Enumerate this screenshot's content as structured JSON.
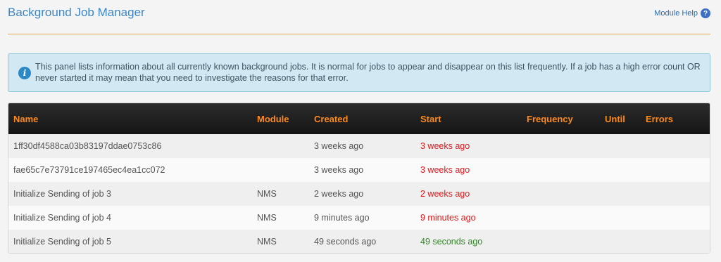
{
  "header": {
    "title": "Background Job Manager",
    "help_label": "Module Help",
    "help_icon": "?"
  },
  "info": {
    "icon": "i",
    "text": "This panel lists information about all currently known background jobs. It is normal for jobs to appear and disappear on this list frequently. If a job has a high error count OR never started it may mean that you need to investigate the reasons for that error."
  },
  "table": {
    "columns": [
      "Name",
      "Module",
      "Created",
      "Start",
      "Frequency",
      "Until",
      "Errors"
    ],
    "rows": [
      {
        "name": "1ff30df4588ca03b83197ddae0753c86",
        "module": "",
        "created": "3 weeks ago",
        "start": "3 weeks ago",
        "start_status": "red",
        "frequency": "",
        "until": "",
        "errors": ""
      },
      {
        "name": "fae65c7e73791ce197465ec4ea1cc072",
        "module": "",
        "created": "3 weeks ago",
        "start": "3 weeks ago",
        "start_status": "red",
        "frequency": "",
        "until": "",
        "errors": ""
      },
      {
        "name": "Initialize Sending of job 3",
        "module": "NMS",
        "created": "2 weeks ago",
        "start": "2 weeks ago",
        "start_status": "red",
        "frequency": "",
        "until": "",
        "errors": ""
      },
      {
        "name": "Initialize Sending of job 4",
        "module": "NMS",
        "created": "9 minutes ago",
        "start": "9 minutes ago",
        "start_status": "red",
        "frequency": "",
        "until": "",
        "errors": ""
      },
      {
        "name": "Initialize Sending of job 5",
        "module": "NMS",
        "created": "49 seconds ago",
        "start": "49 seconds ago",
        "start_status": "green",
        "frequency": "",
        "until": "",
        "errors": ""
      }
    ]
  },
  "colors": {
    "title": "#3d86c6",
    "divider": "#e8a44a",
    "header_text": "#ff8a1c",
    "start_red": "#e0181b",
    "start_green": "#2f8a22"
  }
}
